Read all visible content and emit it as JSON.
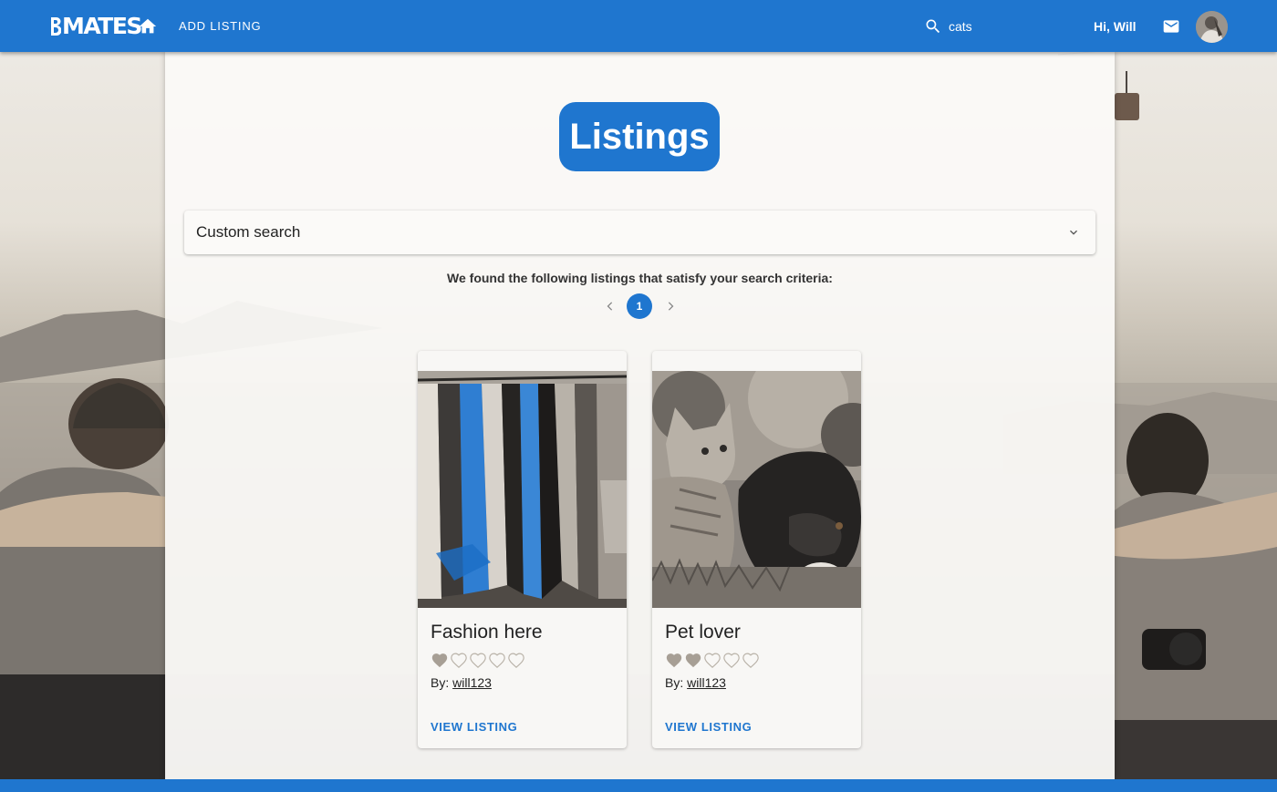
{
  "header": {
    "logo_text": "MATES",
    "add_listing_label": "ADD LISTING",
    "search": {
      "value": "cats",
      "placeholder": ""
    },
    "greeting": "Hi, Will",
    "icons": [
      "home-icon",
      "search-icon",
      "mail-icon",
      "avatar"
    ]
  },
  "main": {
    "title": "Listings",
    "custom_search_label": "Custom search",
    "results_message": "We found the following listings that satisfy your search criteria:",
    "pagination": {
      "current_page": "1",
      "prev": "‹",
      "next": "›"
    },
    "listings": [
      {
        "title": "Fashion here",
        "rating": 1,
        "rating_max": 5,
        "by_label": "By:",
        "author": "will123",
        "action_label": "VIEW LISTING",
        "image": "clothes-rack-photo"
      },
      {
        "title": "Pet lover",
        "rating": 2,
        "rating_max": 5,
        "by_label": "By:",
        "author": "will123",
        "action_label": "VIEW LISTING",
        "image": "cat-and-dog-photo"
      }
    ]
  },
  "colors": {
    "primary": "#1f76cf",
    "panel": "#fbfaf8",
    "heart_filled": "#a79f95",
    "heart_outline": "#b9b2a8"
  }
}
